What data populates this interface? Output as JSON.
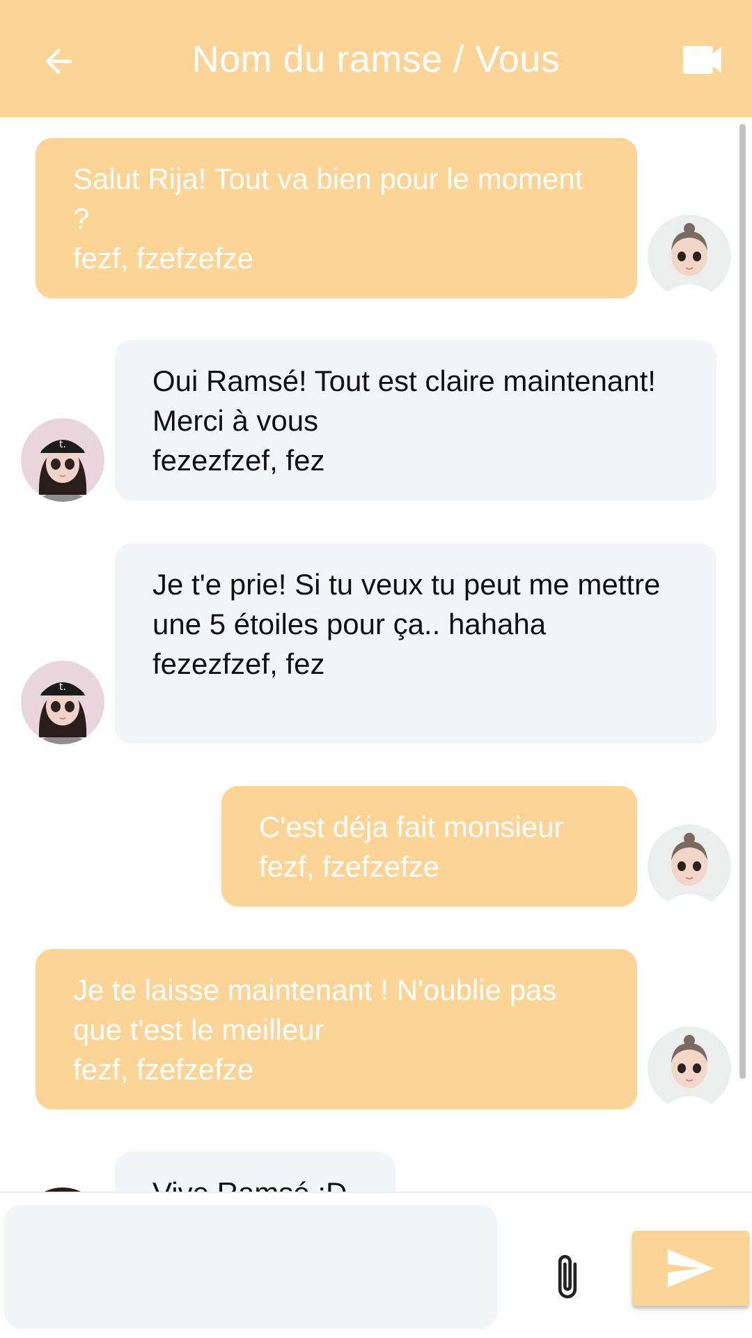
{
  "header": {
    "title": "Nom du ramse / Vous",
    "back_icon": "arrow-back-icon",
    "video_icon": "videocam-icon"
  },
  "colors": {
    "accent": "#fcd495",
    "incoming_bubble": "#f3f4f8",
    "outgoing_text": "#ffffff",
    "incoming_text": "#111111"
  },
  "messages": [
    {
      "sender": "me",
      "text": "Salut Rija! Tout va bien pour le moment ?",
      "meta": "fezf, fzefzefze"
    },
    {
      "sender": "them",
      "text": "Oui Ramsé! Tout est claire maintenant! Merci à vous",
      "meta": "fezezfzef, fez"
    },
    {
      "sender": "them",
      "text": "Je t'e prie! Si tu veux tu peut me mettre une 5 étoiles pour ça.. hahaha",
      "meta": "fezezfzef, fez"
    },
    {
      "sender": "me",
      "text": "C'est déja fait monsieur",
      "meta": "fezf, fzefzefze"
    },
    {
      "sender": "me",
      "text": "Je te laisse maintenant ! N'oublie pas que t'est le meilleur",
      "meta": "fezf, fzefzefze"
    },
    {
      "sender": "them",
      "text": "Vive Ramsé :D",
      "meta": ""
    }
  ],
  "composer": {
    "placeholder": "",
    "attach_icon": "paperclip-icon",
    "send_icon": "send-icon"
  }
}
